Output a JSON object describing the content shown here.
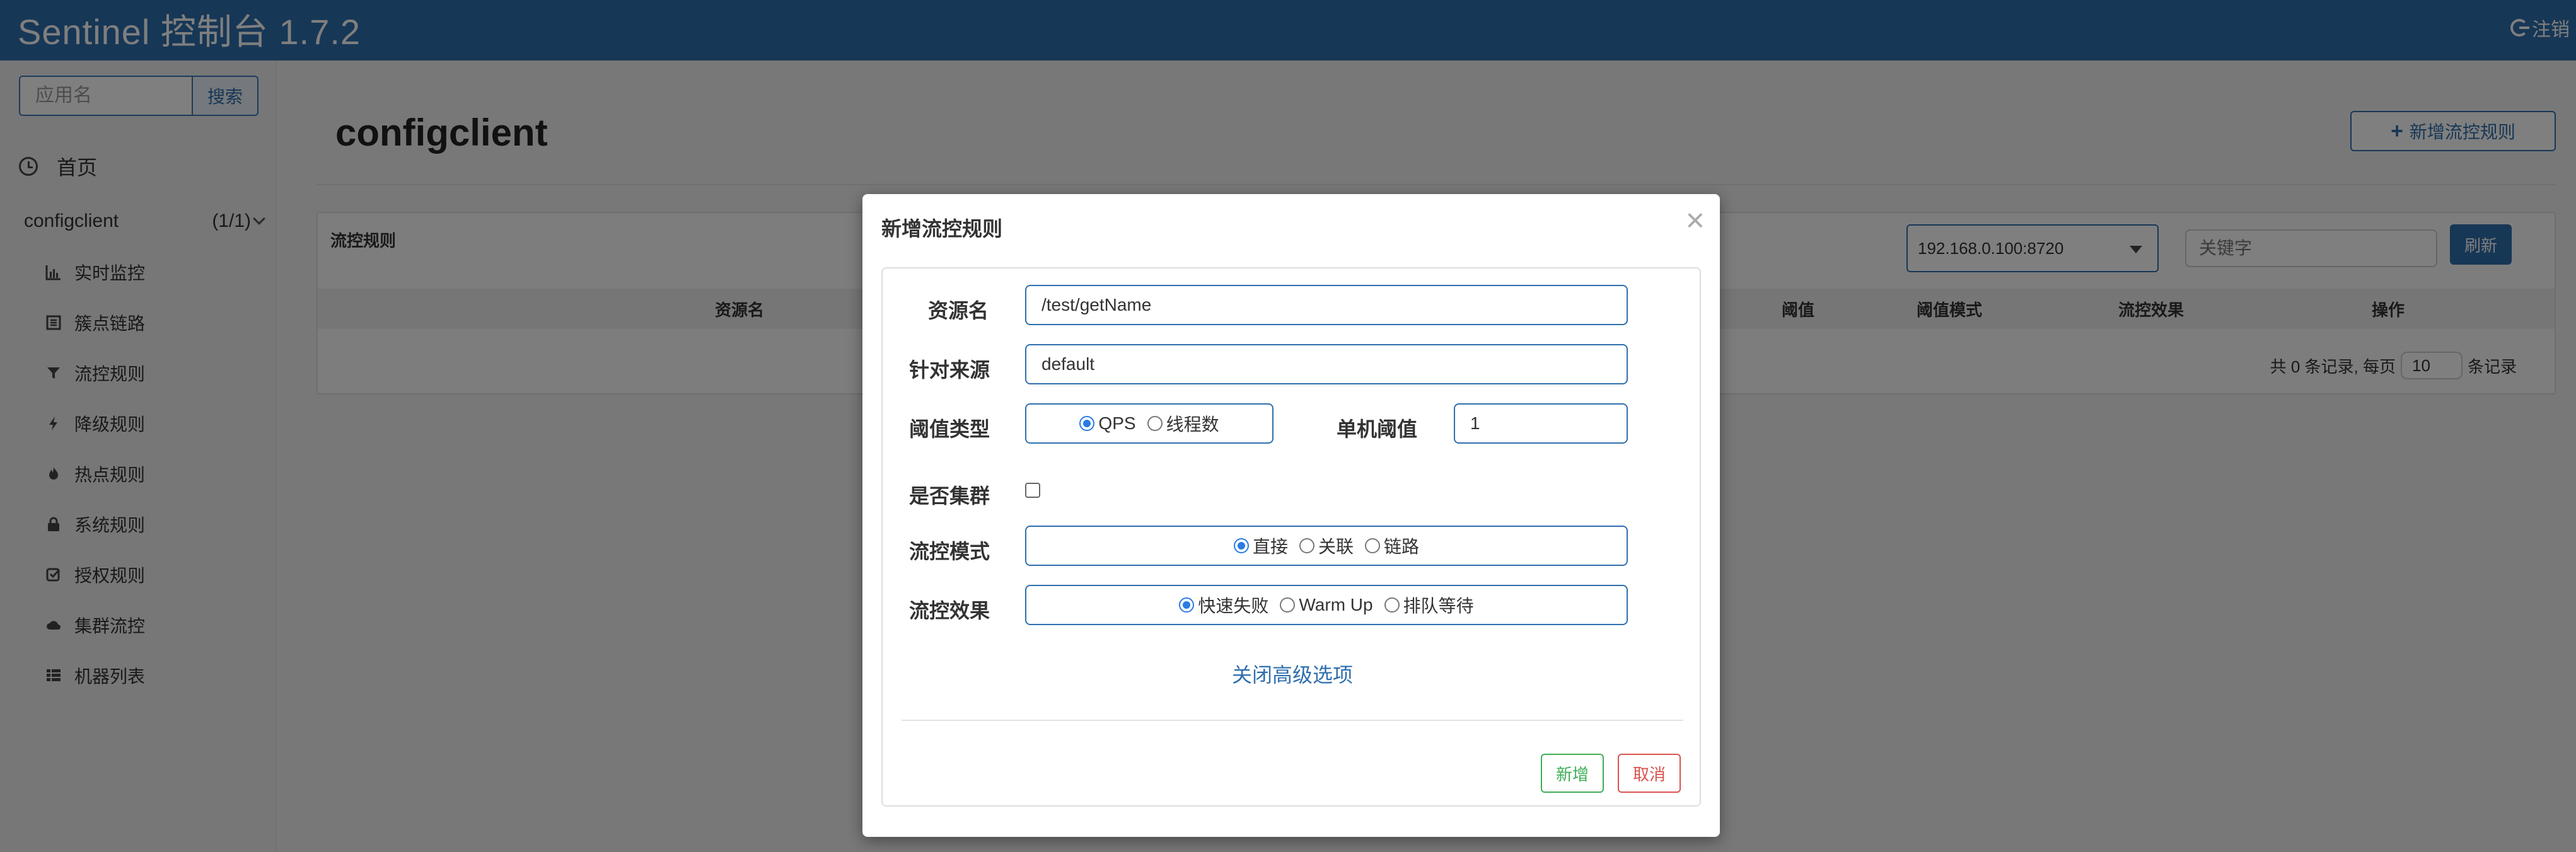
{
  "header": {
    "title": "Sentinel 控制台 1.7.2",
    "logout_label": "注销"
  },
  "sidebar": {
    "search_placeholder": "应用名",
    "search_button": "搜索",
    "home_label": "首页",
    "app": {
      "name": "configclient",
      "count": "(1/1)"
    },
    "items": [
      {
        "label": "实时监控",
        "icon": "bar-chart-icon"
      },
      {
        "label": "簇点链路",
        "icon": "list-icon"
      },
      {
        "label": "流控规则",
        "icon": "filter-icon"
      },
      {
        "label": "降级规则",
        "icon": "flash-icon"
      },
      {
        "label": "热点规则",
        "icon": "fire-icon"
      },
      {
        "label": "系统规则",
        "icon": "lock-icon"
      },
      {
        "label": "授权规则",
        "icon": "check-icon"
      },
      {
        "label": "集群流控",
        "icon": "cloud-icon"
      },
      {
        "label": "机器列表",
        "icon": "th-list-icon"
      }
    ]
  },
  "main": {
    "title": "configclient",
    "add_rule_button": "新增流控规则",
    "panel_title": "流控规则",
    "machine_select": "192.168.0.100:8720",
    "keyword_placeholder": "关键字",
    "refresh_button": "刷新",
    "columns": [
      "资源名",
      "阈值",
      "阈值模式",
      "流控效果",
      "操作"
    ],
    "pager": {
      "prefix": "共 0 条记录, 每页",
      "page_size": "10",
      "suffix": "条记录"
    }
  },
  "modal": {
    "title": "新增流控规则",
    "close_glyph": "×",
    "fields": {
      "resource_label": "资源名",
      "resource_value": "/test/getName",
      "origin_label": "针对来源",
      "origin_value": "default",
      "threshold_type_label": "阈值类型",
      "threshold_type_options": [
        "QPS",
        "线程数"
      ],
      "threshold_type_selected": "QPS",
      "single_threshold_label": "单机阈值",
      "single_threshold_value": "1",
      "cluster_label": "是否集群",
      "cluster_checked": false,
      "mode_label": "流控模式",
      "mode_options": [
        "直接",
        "关联",
        "链路"
      ],
      "mode_selected": "直接",
      "effect_label": "流控效果",
      "effect_options": [
        "快速失败",
        "Warm Up",
        "排队等待"
      ],
      "effect_selected": "快速失败"
    },
    "advanced_link": "关闭高级选项",
    "add_button": "新增",
    "cancel_button": "取消"
  },
  "colors": {
    "header": "#2f6fad",
    "primary": "#2f6fad",
    "success": "#3fae57",
    "danger": "#d9534f"
  }
}
